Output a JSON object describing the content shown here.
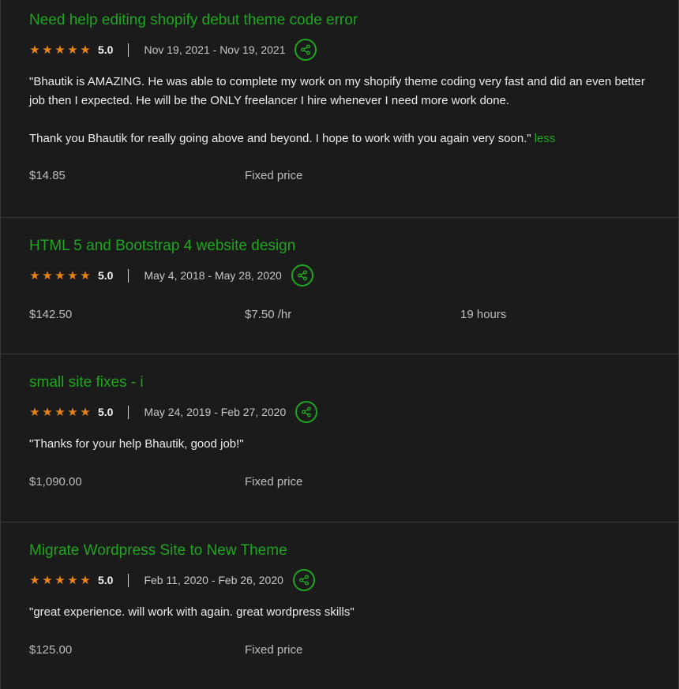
{
  "colors": {
    "background": "#1b1b1b",
    "title_green": "#1fa51f",
    "star_orange": "#e88316",
    "divider": "#3a3a3a"
  },
  "jobs": [
    {
      "title": "Need help editing shopify debut theme code error",
      "stars": 5,
      "rating": "5.0",
      "dates": "Nov 19, 2021 - Nov 19, 2021",
      "feedback": "\"Bhautik is AMAZING. He was able to complete my work on my shopify theme coding very fast and did an even better job then I expected. He will be the ONLY freelancer I hire whenever I need more work done.\n\nThank you Bhautik for really going above and beyond. I hope to work with you again very soon.\"",
      "less_label": "less",
      "amount": "$14.85",
      "price_type": "Fixed price"
    },
    {
      "title": "HTML 5 and Bootstrap 4 website design",
      "stars": 5,
      "rating": "5.0",
      "dates": "May 4, 2018 - May 28, 2020",
      "amount": "$142.50",
      "rate": "$7.50 /hr",
      "hours": "19 hours"
    },
    {
      "title": "small site fixes - i",
      "stars": 5,
      "rating": "5.0",
      "dates": "May 24, 2019 - Feb 27, 2020",
      "feedback": "\"Thanks for your help Bhautik, good job!\"",
      "amount": "$1,090.00",
      "price_type": "Fixed price"
    },
    {
      "title": "Migrate Wordpress Site to New Theme",
      "stars": 5,
      "rating": "5.0",
      "dates": "Feb 11, 2020 - Feb 26, 2020",
      "feedback": "\"great experience. will work with again. great wordpress skills\"",
      "amount": "$125.00",
      "price_type": "Fixed price"
    }
  ],
  "icons": {
    "star": "star-icon",
    "share": "share-icon"
  }
}
